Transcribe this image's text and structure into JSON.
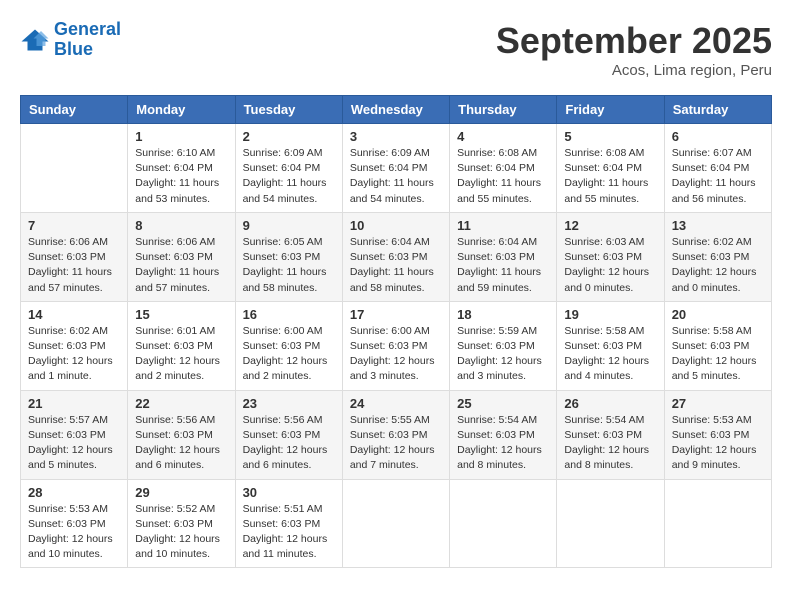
{
  "header": {
    "logo_line1": "General",
    "logo_line2": "Blue",
    "month": "September 2025",
    "location": "Acos, Lima region, Peru"
  },
  "days_of_week": [
    "Sunday",
    "Monday",
    "Tuesday",
    "Wednesday",
    "Thursday",
    "Friday",
    "Saturday"
  ],
  "weeks": [
    [
      {
        "day": "",
        "info": ""
      },
      {
        "day": "1",
        "info": "Sunrise: 6:10 AM\nSunset: 6:04 PM\nDaylight: 11 hours\nand 53 minutes."
      },
      {
        "day": "2",
        "info": "Sunrise: 6:09 AM\nSunset: 6:04 PM\nDaylight: 11 hours\nand 54 minutes."
      },
      {
        "day": "3",
        "info": "Sunrise: 6:09 AM\nSunset: 6:04 PM\nDaylight: 11 hours\nand 54 minutes."
      },
      {
        "day": "4",
        "info": "Sunrise: 6:08 AM\nSunset: 6:04 PM\nDaylight: 11 hours\nand 55 minutes."
      },
      {
        "day": "5",
        "info": "Sunrise: 6:08 AM\nSunset: 6:04 PM\nDaylight: 11 hours\nand 55 minutes."
      },
      {
        "day": "6",
        "info": "Sunrise: 6:07 AM\nSunset: 6:04 PM\nDaylight: 11 hours\nand 56 minutes."
      }
    ],
    [
      {
        "day": "7",
        "info": "Sunrise: 6:06 AM\nSunset: 6:03 PM\nDaylight: 11 hours\nand 57 minutes."
      },
      {
        "day": "8",
        "info": "Sunrise: 6:06 AM\nSunset: 6:03 PM\nDaylight: 11 hours\nand 57 minutes."
      },
      {
        "day": "9",
        "info": "Sunrise: 6:05 AM\nSunset: 6:03 PM\nDaylight: 11 hours\nand 58 minutes."
      },
      {
        "day": "10",
        "info": "Sunrise: 6:04 AM\nSunset: 6:03 PM\nDaylight: 11 hours\nand 58 minutes."
      },
      {
        "day": "11",
        "info": "Sunrise: 6:04 AM\nSunset: 6:03 PM\nDaylight: 11 hours\nand 59 minutes."
      },
      {
        "day": "12",
        "info": "Sunrise: 6:03 AM\nSunset: 6:03 PM\nDaylight: 12 hours\nand 0 minutes."
      },
      {
        "day": "13",
        "info": "Sunrise: 6:02 AM\nSunset: 6:03 PM\nDaylight: 12 hours\nand 0 minutes."
      }
    ],
    [
      {
        "day": "14",
        "info": "Sunrise: 6:02 AM\nSunset: 6:03 PM\nDaylight: 12 hours\nand 1 minute."
      },
      {
        "day": "15",
        "info": "Sunrise: 6:01 AM\nSunset: 6:03 PM\nDaylight: 12 hours\nand 2 minutes."
      },
      {
        "day": "16",
        "info": "Sunrise: 6:00 AM\nSunset: 6:03 PM\nDaylight: 12 hours\nand 2 minutes."
      },
      {
        "day": "17",
        "info": "Sunrise: 6:00 AM\nSunset: 6:03 PM\nDaylight: 12 hours\nand 3 minutes."
      },
      {
        "day": "18",
        "info": "Sunrise: 5:59 AM\nSunset: 6:03 PM\nDaylight: 12 hours\nand 3 minutes."
      },
      {
        "day": "19",
        "info": "Sunrise: 5:58 AM\nSunset: 6:03 PM\nDaylight: 12 hours\nand 4 minutes."
      },
      {
        "day": "20",
        "info": "Sunrise: 5:58 AM\nSunset: 6:03 PM\nDaylight: 12 hours\nand 5 minutes."
      }
    ],
    [
      {
        "day": "21",
        "info": "Sunrise: 5:57 AM\nSunset: 6:03 PM\nDaylight: 12 hours\nand 5 minutes."
      },
      {
        "day": "22",
        "info": "Sunrise: 5:56 AM\nSunset: 6:03 PM\nDaylight: 12 hours\nand 6 minutes."
      },
      {
        "day": "23",
        "info": "Sunrise: 5:56 AM\nSunset: 6:03 PM\nDaylight: 12 hours\nand 6 minutes."
      },
      {
        "day": "24",
        "info": "Sunrise: 5:55 AM\nSunset: 6:03 PM\nDaylight: 12 hours\nand 7 minutes."
      },
      {
        "day": "25",
        "info": "Sunrise: 5:54 AM\nSunset: 6:03 PM\nDaylight: 12 hours\nand 8 minutes."
      },
      {
        "day": "26",
        "info": "Sunrise: 5:54 AM\nSunset: 6:03 PM\nDaylight: 12 hours\nand 8 minutes."
      },
      {
        "day": "27",
        "info": "Sunrise: 5:53 AM\nSunset: 6:03 PM\nDaylight: 12 hours\nand 9 minutes."
      }
    ],
    [
      {
        "day": "28",
        "info": "Sunrise: 5:53 AM\nSunset: 6:03 PM\nDaylight: 12 hours\nand 10 minutes."
      },
      {
        "day": "29",
        "info": "Sunrise: 5:52 AM\nSunset: 6:03 PM\nDaylight: 12 hours\nand 10 minutes."
      },
      {
        "day": "30",
        "info": "Sunrise: 5:51 AM\nSunset: 6:03 PM\nDaylight: 12 hours\nand 11 minutes."
      },
      {
        "day": "",
        "info": ""
      },
      {
        "day": "",
        "info": ""
      },
      {
        "day": "",
        "info": ""
      },
      {
        "day": "",
        "info": ""
      }
    ]
  ]
}
